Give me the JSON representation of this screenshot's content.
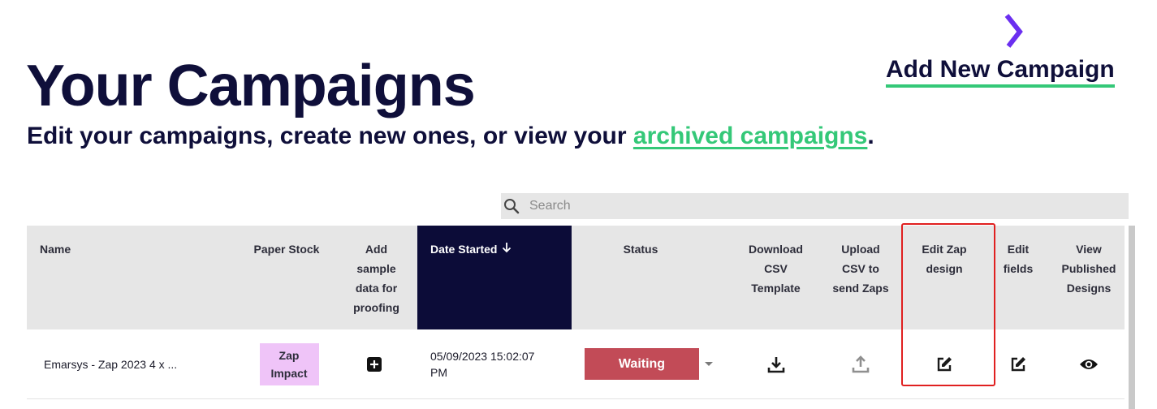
{
  "header": {
    "add_new_label": "Add New Campaign",
    "title": "Your Campaigns",
    "subtitle_prefix": "Edit your campaigns, create new ones, or view your ",
    "subtitle_link": "archived campaigns",
    "subtitle_suffix": "."
  },
  "search": {
    "placeholder": "Search",
    "value": ""
  },
  "table": {
    "columns": {
      "name": "Name",
      "paper_stock": "Paper Stock",
      "add_sample": [
        "Add",
        "sample",
        "data for",
        "proofing"
      ],
      "date_started": "Date Started",
      "status": "Status",
      "download_csv": [
        "Download",
        "CSV",
        "Template"
      ],
      "upload_csv": [
        "Upload",
        "CSV to",
        "send Zaps"
      ],
      "edit_zap": [
        "Edit Zap",
        "design"
      ],
      "edit_fields": [
        "Edit",
        "fields"
      ],
      "view_published": [
        "View",
        "Published",
        "Designs"
      ]
    },
    "sort": {
      "column": "date_started",
      "direction": "descending",
      "icon": "arrow-down-icon"
    },
    "rows": [
      {
        "name": "Emarsys - Zap 2023 4 x ...",
        "paper_stock": [
          "Zap",
          "Impact"
        ],
        "date_started_line1": "05/09/2023 15:02:07",
        "date_started_line2": "PM",
        "status": "Waiting"
      }
    ]
  },
  "colors": {
    "navy": "#0f0f3a",
    "accent_green": "#34c878",
    "logo_purple": "#6b2ff0",
    "status_waiting": "#c24b57",
    "badge_pink": "#efc4f8",
    "highlight_red": "#e02020"
  },
  "icons": [
    "logo-icon",
    "search-icon",
    "plus-square-icon",
    "download-icon",
    "upload-icon",
    "edit-icon",
    "eye-icon"
  ]
}
